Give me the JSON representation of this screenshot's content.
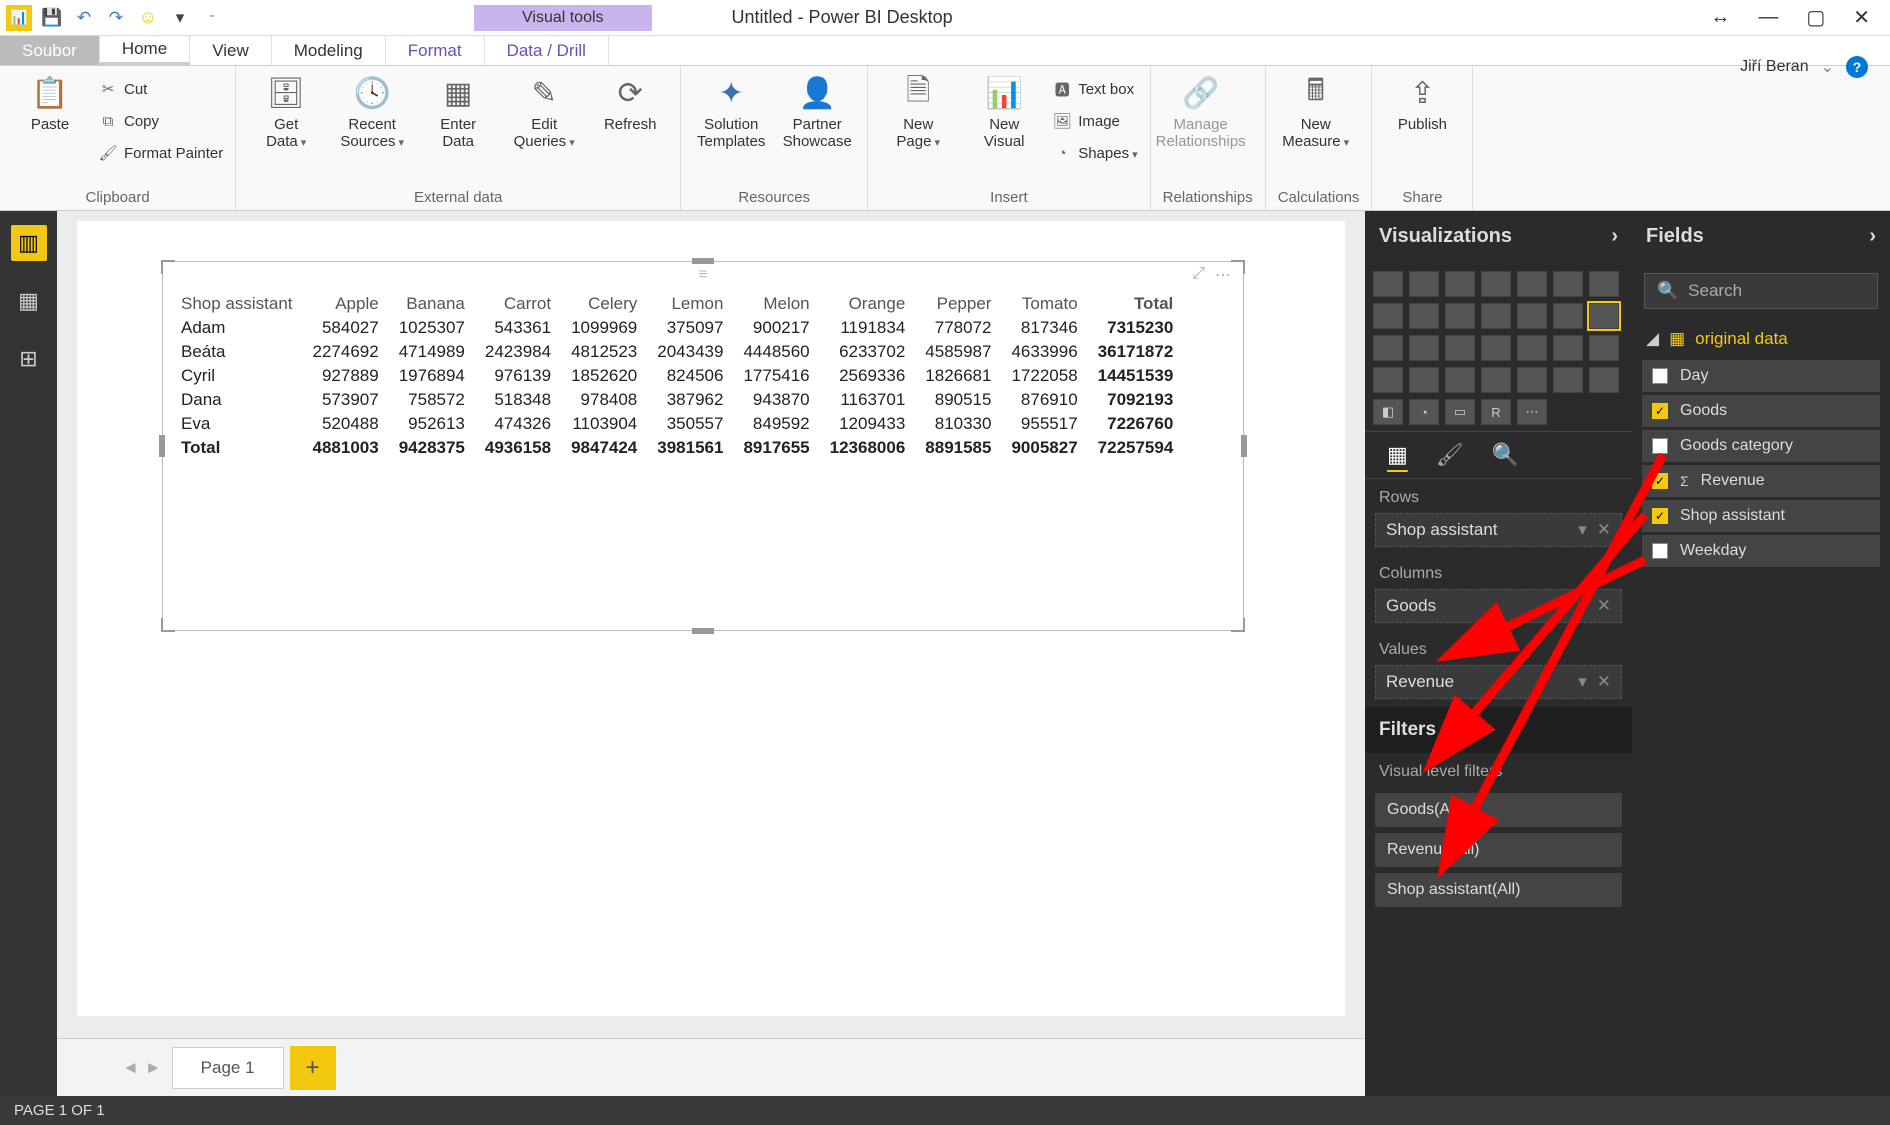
{
  "title": "Untitled - Power BI Desktop",
  "visual_tools_label": "Visual tools",
  "user_name": "Jiří Beran",
  "tabs": {
    "file": "Soubor",
    "home": "Home",
    "view": "View",
    "modeling": "Modeling",
    "format": "Format",
    "drill": "Data / Drill"
  },
  "ribbon": {
    "clipboard": {
      "paste": "Paste",
      "cut": "Cut",
      "copy": "Copy",
      "fmt": "Format Painter",
      "label": "Clipboard"
    },
    "external": {
      "get": "Get\nData",
      "recent": "Recent\nSources",
      "enter": "Enter\nData",
      "edit": "Edit\nQueries",
      "refresh": "Refresh",
      "label": "External data"
    },
    "resources": {
      "sol": "Solution\nTemplates",
      "partner": "Partner\nShowcase",
      "label": "Resources"
    },
    "insert": {
      "page": "New\nPage",
      "visual": "New\nVisual",
      "textbox": "Text box",
      "image": "Image",
      "shapes": "Shapes",
      "label": "Insert"
    },
    "rel": {
      "manage": "Manage\nRelationships",
      "label": "Relationships"
    },
    "calc": {
      "measure": "New\nMeasure",
      "label": "Calculations"
    },
    "share": {
      "publish": "Publish",
      "label": "Share"
    }
  },
  "chart_data": {
    "type": "table",
    "row_field": "Shop assistant",
    "column_field": "Goods",
    "value_field": "Revenue",
    "columns": [
      "Apple",
      "Banana",
      "Carrot",
      "Celery",
      "Lemon",
      "Melon",
      "Orange",
      "Pepper",
      "Tomato",
      "Total"
    ],
    "rows": [
      {
        "name": "Adam",
        "v": [
          584027,
          1025307,
          543361,
          1099969,
          375097,
          900217,
          1191834,
          778072,
          817346,
          7315230
        ]
      },
      {
        "name": "Beáta",
        "v": [
          2274692,
          4714989,
          2423984,
          4812523,
          2043439,
          4448560,
          6233702,
          4585987,
          4633996,
          36171872
        ]
      },
      {
        "name": "Cyril",
        "v": [
          927889,
          1976894,
          976139,
          1852620,
          824506,
          1775416,
          2569336,
          1826681,
          1722058,
          14451539
        ]
      },
      {
        "name": "Dana",
        "v": [
          573907,
          758572,
          518348,
          978408,
          387962,
          943870,
          1163701,
          890515,
          876910,
          7092193
        ]
      },
      {
        "name": "Eva",
        "v": [
          520488,
          952613,
          474326,
          1103904,
          350557,
          849592,
          1209433,
          810330,
          955517,
          7226760
        ]
      }
    ],
    "totals": [
      4881003,
      9428375,
      4936158,
      9847424,
      3981561,
      8917655,
      12368006,
      8891585,
      9005827,
      72257594
    ],
    "total_label": "Total"
  },
  "page_tab": "Page 1",
  "status": "PAGE 1 OF 1",
  "viz_pane": {
    "title": "Visualizations",
    "rows_label": "Rows",
    "rows_value": "Shop assistant",
    "cols_label": "Columns",
    "cols_value": "Goods",
    "vals_label": "Values",
    "vals_value": "Revenue",
    "filters_title": "Filters",
    "vlf_label": "Visual level filters",
    "filters": [
      "Goods(All)",
      "Revenue(All)",
      "Shop assistant(All)"
    ]
  },
  "fields_pane": {
    "title": "Fields",
    "search_placeholder": "Search",
    "table": "original data",
    "fields": [
      {
        "name": "Day",
        "checked": false,
        "sigma": false
      },
      {
        "name": "Goods",
        "checked": true,
        "sigma": false
      },
      {
        "name": "Goods category",
        "checked": false,
        "sigma": false
      },
      {
        "name": "Revenue",
        "checked": true,
        "sigma": true
      },
      {
        "name": "Shop assistant",
        "checked": true,
        "sigma": false
      },
      {
        "name": "Weekday",
        "checked": false,
        "sigma": false
      }
    ]
  }
}
